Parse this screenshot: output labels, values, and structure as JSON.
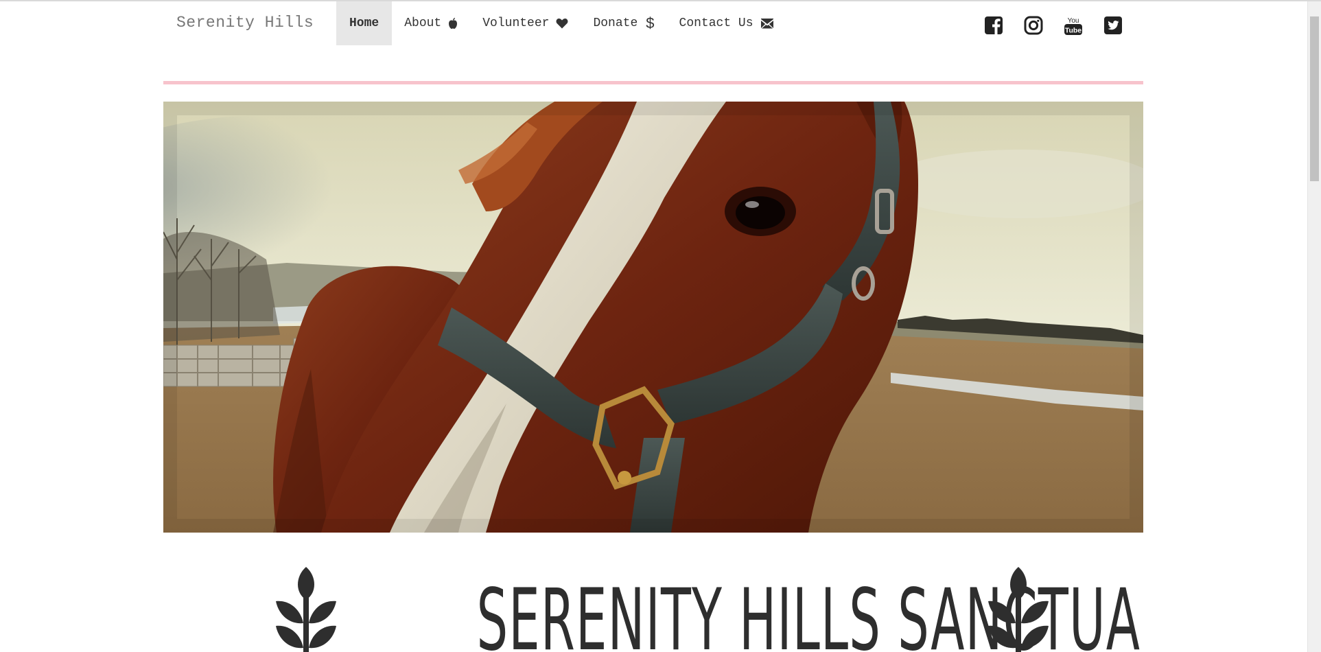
{
  "navbar": {
    "brand": "Serenity Hills",
    "items": [
      {
        "label": "Home",
        "icon": null,
        "active": true
      },
      {
        "label": "About",
        "icon": "apple-icon",
        "active": false
      },
      {
        "label": "Volunteer",
        "icon": "heart-icon",
        "active": false
      },
      {
        "label": "Donate",
        "icon": "dollar-icon",
        "glyph": "$",
        "active": false
      },
      {
        "label": "Contact Us",
        "icon": "envelope-icon",
        "active": false
      }
    ],
    "social": [
      {
        "name": "facebook-icon"
      },
      {
        "name": "instagram-icon"
      },
      {
        "name": "youtube-icon",
        "line1": "You",
        "line2": "Tube"
      },
      {
        "name": "twitter-icon"
      }
    ]
  },
  "hero": {
    "subject": "horse-photo"
  },
  "title": {
    "text": "SERENITY HILLS SANCTUARY",
    "decoration": "wheat-icon"
  },
  "colors": {
    "accent_rule": "#f7c3cc",
    "active_nav_bg": "#e7e7e7",
    "text_dark": "#333333",
    "brand_grey": "#777777"
  }
}
